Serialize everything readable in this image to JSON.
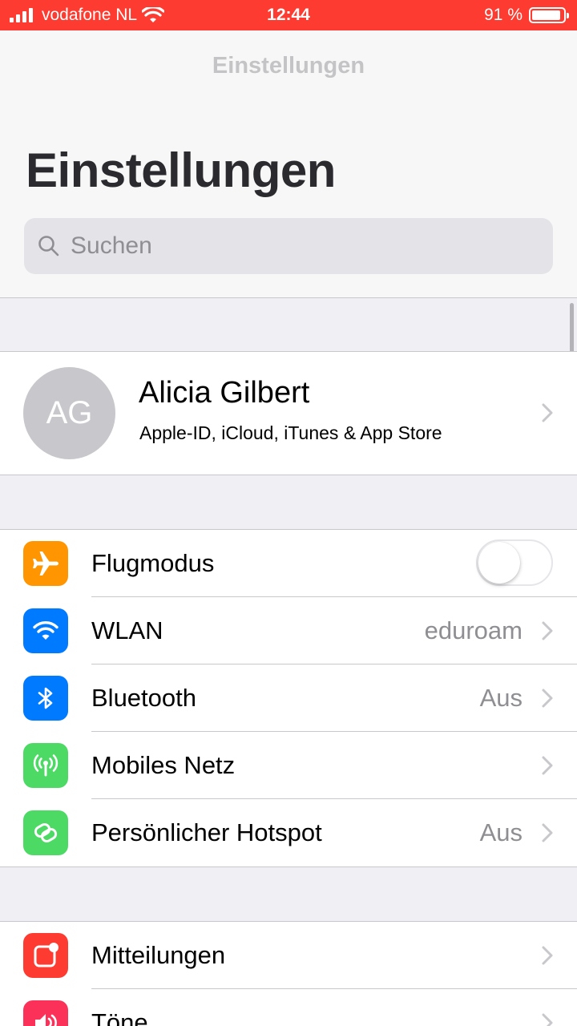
{
  "status_bar": {
    "carrier": "vodafone NL",
    "time": "12:44",
    "battery_percent": "91 %",
    "battery_level": 0.91,
    "color": "#fd3b30"
  },
  "header": {
    "nav_title": "Einstellungen",
    "large_title": "Einstellungen",
    "search_placeholder": "Suchen"
  },
  "profile": {
    "initials": "AG",
    "name": "Alicia Gilbert",
    "subtitle": "Apple-ID, iCloud, iTunes & App Store"
  },
  "connectivity": [
    {
      "label": "Flugmodus",
      "icon": "airplane-icon",
      "color": "#ff9500",
      "toggle": false
    },
    {
      "label": "WLAN",
      "value": "eduroam",
      "icon": "wifi-icon",
      "color": "#007aff"
    },
    {
      "label": "Bluetooth",
      "value": "Aus",
      "icon": "bluetooth-icon",
      "color": "#007aff"
    },
    {
      "label": "Mobiles Netz",
      "value": "",
      "icon": "cellular-icon",
      "color": "#4cd964"
    },
    {
      "label": "Persönlicher Hotspot",
      "value": "Aus",
      "icon": "hotspot-icon",
      "color": "#4cd964"
    }
  ],
  "notifications": [
    {
      "label": "Mitteilungen",
      "icon": "notifications-icon",
      "color": "#fd3b30"
    },
    {
      "label": "Töne",
      "icon": "sounds-icon",
      "color": "#fc3159"
    }
  ]
}
